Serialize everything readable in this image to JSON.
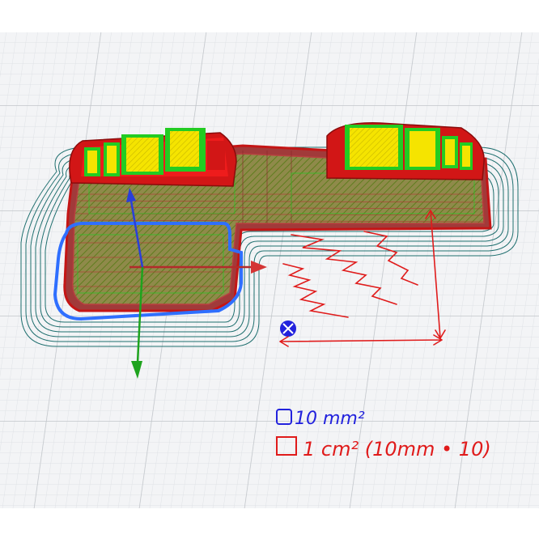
{
  "scene": {
    "annotations": {
      "blue_legend": "10 mm²",
      "red_legend": "1 cm² (10mm • 10)"
    },
    "colors": {
      "background": "#f3f4f6",
      "grid_minor": "#dfe2e6",
      "grid_major": "#c4c8cd",
      "skirt": "#1f6f6f",
      "wall": "#d41919",
      "infill": "#7b8a2a",
      "top_solid": "#ffe800",
      "inner_wall": "#22cc22",
      "selection": "#2f6fff",
      "axis_x": "#d43535",
      "axis_y": "#1ea31e",
      "axis_z": "#2a3fd8",
      "annotation_red": "#e01b1b",
      "annotation_blue": "#2222dd"
    },
    "icons": [
      "origin-gizmo-icon"
    ]
  }
}
